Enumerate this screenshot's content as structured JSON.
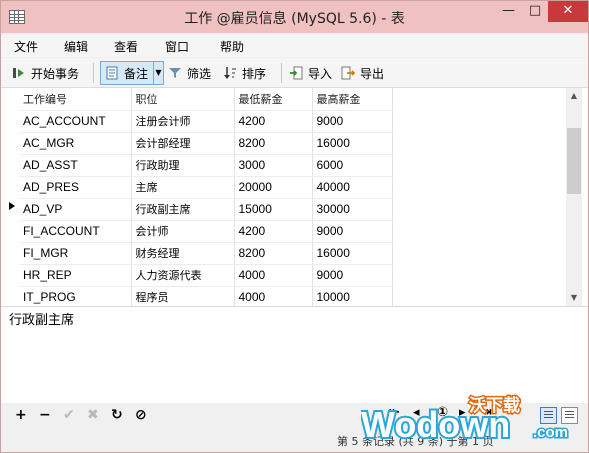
{
  "window": {
    "title": "工作 @雇员信息 (MySQL 5.6) - 表",
    "min": "—",
    "max": "□",
    "close": "✕"
  },
  "menu": [
    "文件",
    "编辑",
    "查看",
    "窗口",
    "帮助"
  ],
  "toolbar": {
    "begin_transaction": "开始事务",
    "memo": "备注",
    "filter": "筛选",
    "sort": "排序",
    "import": "导入",
    "export": "导出"
  },
  "grid": {
    "headers": [
      "工作编号",
      "职位",
      "最低薪金",
      "最高薪金"
    ],
    "rows": [
      [
        "AC_ACCOUNT",
        "注册会计师",
        "4200",
        "9000"
      ],
      [
        "AC_MGR",
        "会计部经理",
        "8200",
        "16000"
      ],
      [
        "AD_ASST",
        "行政助理",
        "3000",
        "6000"
      ],
      [
        "AD_PRES",
        "主席",
        "20000",
        "40000"
      ],
      [
        "AD_VP",
        "行政副主席",
        "15000",
        "30000"
      ],
      [
        "FI_ACCOUNT",
        "会计师",
        "4200",
        "9000"
      ],
      [
        "FI_MGR",
        "财务经理",
        "8200",
        "16000"
      ],
      [
        "HR_REP",
        "人力资源代表",
        "4000",
        "9000"
      ],
      [
        "IT_PROG",
        "程序员",
        "4000",
        "10000"
      ]
    ],
    "current_row": 4
  },
  "editor": {
    "value": "行政副主席"
  },
  "bottom": {
    "add": "+",
    "delete": "−",
    "apply": "✔",
    "cancel": "✖",
    "refresh": "↻",
    "stop": "⊘"
  },
  "status": {
    "text": "第 5 条记录 (共 9 条) 于第 1 页"
  },
  "watermark": {
    "brand_cn": "沃下载",
    "brand": "Wodown",
    "domain": ".com"
  },
  "colors": {
    "close": "#c7393a",
    "accent": "#3a7bd5",
    "titlebar": "#efc1c1"
  }
}
